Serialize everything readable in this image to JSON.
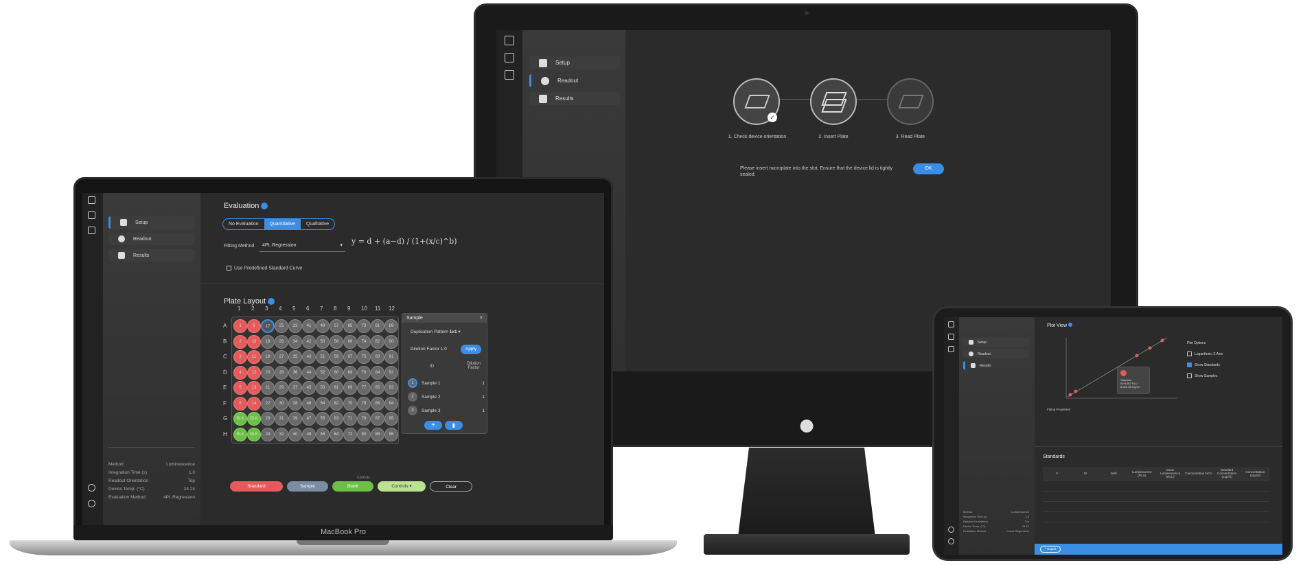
{
  "monitor": {
    "nav": {
      "setup": "Setup",
      "readout": "Readout",
      "results": "Results"
    },
    "steps": [
      {
        "label": "1. Check device orientation"
      },
      {
        "label": "2. Insert Plate"
      },
      {
        "label": "3. Read Plate"
      }
    ],
    "instruction": "Please insert microplate into the slot. Ensure that the device lid is tightly sealed.",
    "ok_label": "OK"
  },
  "laptop": {
    "brand": "MacBook Pro",
    "nav": {
      "setup": "Setup",
      "readout": "Readout",
      "results": "Results"
    },
    "evaluation": {
      "title": "Evaluation",
      "segments": [
        "No Evaluation",
        "Quantitative",
        "Qualitative"
      ],
      "selected": "Quantitative",
      "fitting_label": "Fitting Method",
      "fitting_value": "4PL Regression",
      "formula": "y = d + (a−d) / (1+(x/c)^b)",
      "predefined_label": "Use Predefined Standard Curve"
    },
    "plate": {
      "title": "Plate Layout",
      "columns": [
        "1",
        "2",
        "3",
        "4",
        "5",
        "6",
        "7",
        "8",
        "9",
        "10",
        "11",
        "12"
      ],
      "rows": [
        "A",
        "B",
        "C",
        "D",
        "E",
        "F",
        "G",
        "H"
      ]
    },
    "sample_panel": {
      "title": "Sample",
      "duplication_label": "Duplication Pattern",
      "duplication_value": "1x1",
      "dilution_label": "Dilution Factor",
      "dilution_value": "1.0",
      "apply": "Apply",
      "col_id": "ID",
      "col_dilution": "Dilution Factor",
      "samples": [
        {
          "n": "1",
          "name": "Sample 1",
          "factor": "1"
        },
        {
          "n": "2",
          "name": "Sample 2",
          "factor": "1"
        },
        {
          "n": "3",
          "name": "Sample 3",
          "factor": "1"
        }
      ]
    },
    "controls_caption": "Controls",
    "buttons": {
      "standard": "Standard",
      "sample": "Sample",
      "blank": "Blank",
      "controls": "Controls",
      "clear": "Clear"
    },
    "info": [
      {
        "k": "Method",
        "v": "Luminescence"
      },
      {
        "k": "Integration Time (s)",
        "v": "1.0"
      },
      {
        "k": "Readout Orientation",
        "v": "Top"
      },
      {
        "k": "Device Temp. (°C)",
        "v": "24.24"
      },
      {
        "k": "Evaluation Method",
        "v": "4PL Regression"
      }
    ]
  },
  "tablet": {
    "nav": {
      "setup": "Setup",
      "readout": "Readout",
      "results": "Results"
    },
    "plot_title": "Plot View",
    "plot_options": {
      "title": "Plot Options",
      "items": [
        {
          "label": "Logarithmic X Axis",
          "checked": false
        },
        {
          "label": "Show Standards",
          "checked": true
        },
        {
          "label": "Show Samples",
          "checked": false
        }
      ]
    },
    "tooltip": {
      "title": "Standard",
      "line1": "6291382 RLU",
      "line2": "6.29e-06 mg/ml"
    },
    "fitting_title": "Fitting Properties",
    "standards_title": "Standards",
    "table_headers": [
      "#",
      "ID",
      "Well",
      "Luminescence (RLU)",
      "Mean Luminescence (RLU)",
      "Concentration %CV",
      "Standard Concentration (mg/ml)",
      "Concentration (mg/ml)"
    ],
    "export_label": "Export",
    "info": [
      {
        "k": "Method",
        "v": "Luminescence"
      },
      {
        "k": "Integration Time (s)",
        "v": "1.0"
      },
      {
        "k": "Readout Orientation",
        "v": "Top"
      },
      {
        "k": "Device Temp. (°C)",
        "v": "24.24"
      },
      {
        "k": "Evaluation Method",
        "v": "Linear Regression"
      }
    ]
  },
  "colors": {
    "accent": "#3a8ee6",
    "standard": "#e55a5a",
    "blank": "#6cc046",
    "controls": "#b9e38e",
    "screen_bg": "#2b2b2b",
    "sidebar_bg": "#3a3a3a"
  }
}
